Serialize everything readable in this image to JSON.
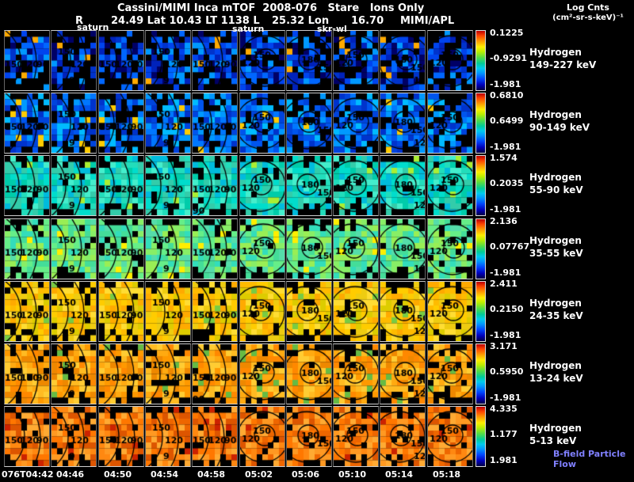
{
  "header": {
    "title": "Cassini/MIMI Inca mTOF  2008-076   Stare   Ions Only",
    "units_line1": "Log Cnts",
    "units_line2": "(cm²-sr-s-keV)⁻¹",
    "ephemeris": {
      "r_label": "R",
      "r_values": "24.49 Lat 10.43 LT 1138 L",
      "lon": "25.32 Lon",
      "lon_value": "16.70",
      "credit": "MIMI/APL"
    },
    "overlay_labels": {
      "saturn1": "saturn",
      "saturn2": "saturn",
      "skr": "skr-wl"
    }
  },
  "rows": [
    {
      "species": "Hydrogen",
      "range": "149-227 keV",
      "cb": {
        "top": "0.1225",
        "mid": "-0.9291",
        "bot": "-1.981"
      },
      "palette": [
        "#000066",
        "#0022bb",
        "#0044ee",
        "#0066ff",
        "#0033cc",
        "#0099ff",
        "#ffaa00"
      ]
    },
    {
      "species": "Hydrogen",
      "range": "90-149 keV",
      "cb": {
        "top": "0.6810",
        "mid": "0.6499",
        "bot": "-1.981"
      },
      "palette": [
        "#0033cc",
        "#0055ee",
        "#0077ff",
        "#0099ff",
        "#00bbff",
        "#0044dd",
        "#ffcc00"
      ]
    },
    {
      "species": "Hydrogen",
      "range": "55-90 keV",
      "cb": {
        "top": "1.574",
        "mid": "0.2035",
        "bot": "-1.981"
      },
      "palette": [
        "#00ccaa",
        "#22ddbb",
        "#00ddcc",
        "#44eecc",
        "#33ccaa",
        "#00bbdd",
        "#aaee33"
      ]
    },
    {
      "species": "Hydrogen",
      "range": "35-55 keV",
      "cb": {
        "top": "2.136",
        "mid": "0.07767",
        "bot": "-1.981"
      },
      "palette": [
        "#44dd99",
        "#66ee88",
        "#88ee66",
        "#55ddaa",
        "#99ee55",
        "#33ddbb",
        "#ffee00"
      ]
    },
    {
      "species": "Hydrogen",
      "range": "24-35 keV",
      "cb": {
        "top": "2.411",
        "mid": "0.2150",
        "bot": "-1.981"
      },
      "palette": [
        "#ffcc00",
        "#ffbb00",
        "#eecc11",
        "#ffdd33",
        "#ddcc00",
        "#ffaa00",
        "#77cc44"
      ]
    },
    {
      "species": "Hydrogen",
      "range": "13-24 keV",
      "cb": {
        "top": "3.171",
        "mid": "0.5950",
        "bot": "-1.981"
      },
      "palette": [
        "#ff9900",
        "#ffaa11",
        "#ff8800",
        "#ffbb22",
        "#ee8800",
        "#ffcc33",
        "#66bb44"
      ]
    },
    {
      "species": "Hydrogen",
      "range": "5-13 keV",
      "cb": {
        "top": "4.335",
        "mid": "1.177",
        "bot": "1.981"
      },
      "palette": [
        "#ff7700",
        "#ff8811",
        "#ee6600",
        "#ff9922",
        "#dd5500",
        "#ffaa33",
        "#cc2200"
      ],
      "flow_label": "B-field Particle Flow",
      "flow_color": "#8080ff"
    }
  ],
  "contours": {
    "left": [
      "150",
      "120",
      "90"
    ],
    "ring": [
      "180",
      "150",
      "120"
    ],
    "extra": [
      "9",
      "12",
      "90"
    ]
  },
  "time_axis": [
    "076T04:42",
    "04:46",
    "04:50",
    "04:54",
    "04:58",
    "05:02",
    "05:06",
    "05:10",
    "05:14",
    "05:18"
  ],
  "chart_data": {
    "type": "heatmap",
    "title": "Cassini/MIMI Inca mTOF 2008-076 Stare Ions Only",
    "colorbar_units": "Log Cnts (cm²-sr-s-keV)⁻¹",
    "colormap": "jet",
    "x_ticks": [
      "076T04:42",
      "04:46",
      "04:50",
      "04:54",
      "04:58",
      "05:02",
      "05:06",
      "05:10",
      "05:14",
      "05:18"
    ],
    "ephemeris": "R 24.49 Lat 10.43 LT 1138 L 25.32 Lon 16.70",
    "source": "MIMI/APL",
    "series": [
      {
        "name": "Hydrogen 149-227 keV",
        "scale_max": 0.1225,
        "scale_mid": -0.9291,
        "scale_min": -1.981
      },
      {
        "name": "Hydrogen 90-149 keV",
        "scale_max": 0.681,
        "scale_mid": 0.6499,
        "scale_min": -1.981
      },
      {
        "name": "Hydrogen 55-90 keV",
        "scale_max": 1.574,
        "scale_mid": 0.2035,
        "scale_min": -1.981
      },
      {
        "name": "Hydrogen 35-55 keV",
        "scale_max": 2.136,
        "scale_mid": 0.07767,
        "scale_min": -1.981
      },
      {
        "name": "Hydrogen 24-35 keV",
        "scale_max": 2.411,
        "scale_mid": 0.215,
        "scale_min": -1.981
      },
      {
        "name": "Hydrogen 13-24 keV",
        "scale_max": 3.171,
        "scale_mid": 0.595,
        "scale_min": -1.981
      },
      {
        "name": "Hydrogen 5-13 keV",
        "scale_max": 4.335,
        "scale_mid": 1.177,
        "scale_min": 1.981
      }
    ],
    "pitch_angle_contours_deg": [
      90,
      120,
      150,
      180
    ],
    "annotations": [
      "saturn",
      "saturn",
      "skr-wl",
      "B-field Particle Flow"
    ]
  }
}
